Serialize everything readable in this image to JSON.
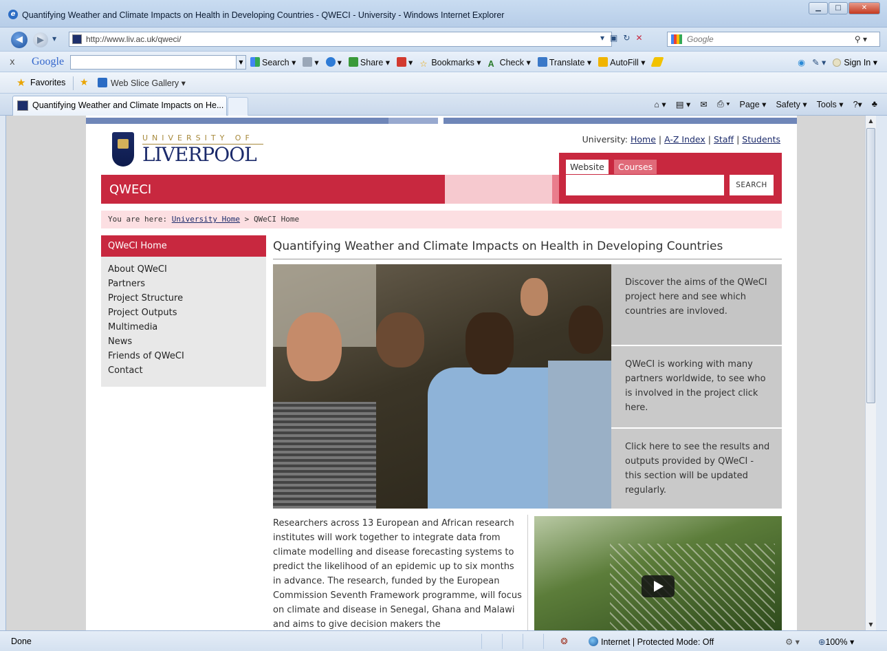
{
  "window": {
    "title": "Quantifying Weather and Climate Impacts on Health in Developing Countries - QWECI - University  - Windows Internet Explorer"
  },
  "address": {
    "url": "http://www.liv.ac.uk/qweci/",
    "search_placeholder": "Google"
  },
  "google_toolbar": {
    "close": "x",
    "logo": "Google",
    "items": [
      "Search ▾",
      "Share ▾",
      "Bookmarks ▾",
      "Check ▾",
      "Translate ▾",
      "AutoFill ▾"
    ],
    "sign_in": "Sign In ▾"
  },
  "favorites_bar": {
    "favorites_label": "Favorites",
    "web_slice_gallery": "Web Slice Gallery ▾"
  },
  "tab": {
    "label": "Quantifying Weather and Climate Impacts on He..."
  },
  "command_bar": {
    "items": [
      "Page ▾",
      "Safety ▾",
      "Tools ▾"
    ]
  },
  "site": {
    "logo_top": "UNIVERSITY OF",
    "logo_main": "LIVERPOOL",
    "util_prefix": "University:",
    "util_links": [
      "Home",
      "A-Z Index",
      "Staff",
      "Students"
    ],
    "site_title": "QWECI",
    "search_tabs": [
      "Website",
      "Courses"
    ],
    "search_button": "SEARCH",
    "breadcrumb_prefix": "You are here:",
    "breadcrumb_link": "University Home",
    "breadcrumb_current": "QWeCI Home",
    "nav_active": "QWeCI Home",
    "nav_items": [
      "About QWeCI",
      "Partners",
      "Project Structure",
      "Project Outputs",
      "Multimedia",
      "News",
      "Friends of QWeCI",
      "Contact"
    ],
    "page_heading": "Quantifying Weather and Climate Impacts on Health in Developing Countries",
    "features": [
      "Discover the aims of the QWeCI project here and see which countries are invloved.",
      "QWeCI is working with many partners worldwide, to see who is involved in the project click here.",
      "Click here to see the results and outputs provided by QWeCI - this section will be updated regularly."
    ],
    "body_text": "Researchers across 13 European and African research institutes will work together to integrate data from climate modelling and disease forecasting systems to predict the likelihood of an epidemic up to six months in advance. The research, funded by the European Commission Seventh Framework programme, will focus on climate and disease in Senegal, Ghana and Malawi and aims to give decision makers the"
  },
  "status": {
    "left": "Done",
    "zone": "Internet | Protected Mode: Off",
    "zoom": "100%"
  }
}
